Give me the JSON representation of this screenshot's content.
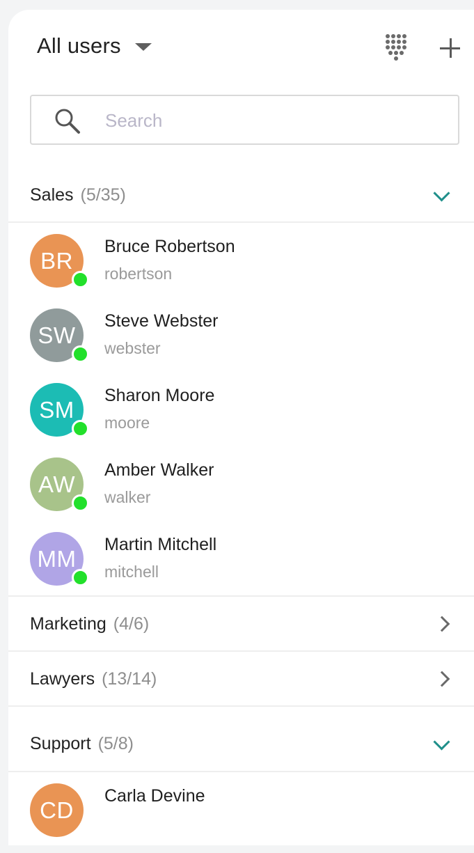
{
  "header": {
    "title": "All users",
    "icons": {
      "view_switch": "caret-down-icon",
      "dialpad": "dialpad-icon",
      "add": "plus-icon"
    }
  },
  "search": {
    "placeholder": "Search",
    "value": ""
  },
  "colors": {
    "accent": "#1f8f8a",
    "online": "#22e02b"
  },
  "groups": [
    {
      "name": "Sales",
      "count": "(5/35)",
      "expanded": true,
      "users": [
        {
          "initials": "BR",
          "name": "Bruce Robertson",
          "login": "robertson",
          "color": "#e99454",
          "status": "online"
        },
        {
          "initials": "SW",
          "name": "Steve Webster",
          "login": "webster",
          "color": "#909b9b",
          "status": "online"
        },
        {
          "initials": "SM",
          "name": "Sharon Moore",
          "login": "moore",
          "color": "#1cbcb4",
          "status": "online"
        },
        {
          "initials": "AW",
          "name": "Amber Walker",
          "login": "walker",
          "color": "#a8c38a",
          "status": "online"
        },
        {
          "initials": "MM",
          "name": "Martin Mitchell",
          "login": "mitchell",
          "color": "#b0a5e6",
          "status": "online"
        }
      ]
    },
    {
      "name": "Marketing",
      "count": "(4/6)",
      "expanded": false
    },
    {
      "name": "Lawyers",
      "count": "(13/14)",
      "expanded": false
    },
    {
      "name": "Support",
      "count": "(5/8)",
      "expanded": true,
      "users": [
        {
          "initials": "CD",
          "name": "Carla Devine",
          "login": "",
          "color": "#e99454",
          "status": "online"
        }
      ]
    }
  ]
}
